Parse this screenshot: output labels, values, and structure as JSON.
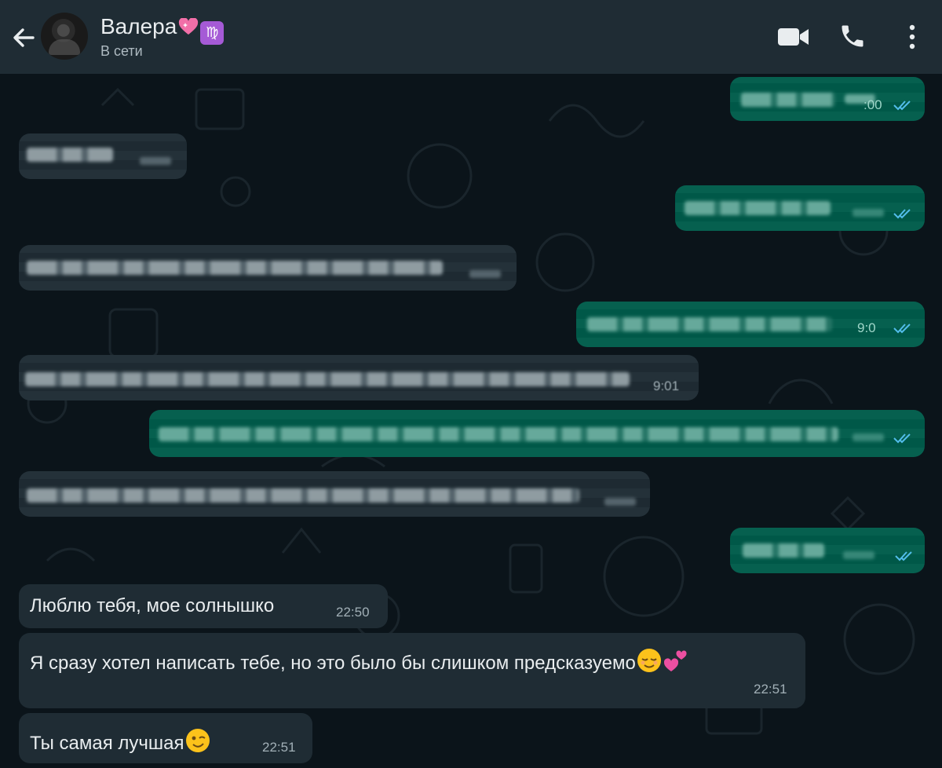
{
  "header": {
    "contact_name": "Валера",
    "heart_emoji": "sparkling-heart",
    "badge_icon": "virgo-zodiac-icon",
    "badge_text": "♍",
    "status": "В сети"
  },
  "messages": {
    "out1_time": ":00",
    "out2_time": "9:0",
    "in_blur_time": "9:01",
    "love": {
      "text": "Люблю тебя, мое солнышко",
      "time": "22:50"
    },
    "wanted": {
      "text": "Я сразу хотел написать тебе, но это было бы слишком предсказуемо",
      "time": "22:51"
    },
    "best": {
      "text": "Ты самая лучшая",
      "time": "22:51"
    }
  },
  "colors": {
    "header_bg": "#1f2c34",
    "chat_bg": "#0b141a",
    "incoming_bubble": "#1f2c34",
    "outgoing_bubble": "#005c4b",
    "read_ticks": "#53bdeb"
  }
}
